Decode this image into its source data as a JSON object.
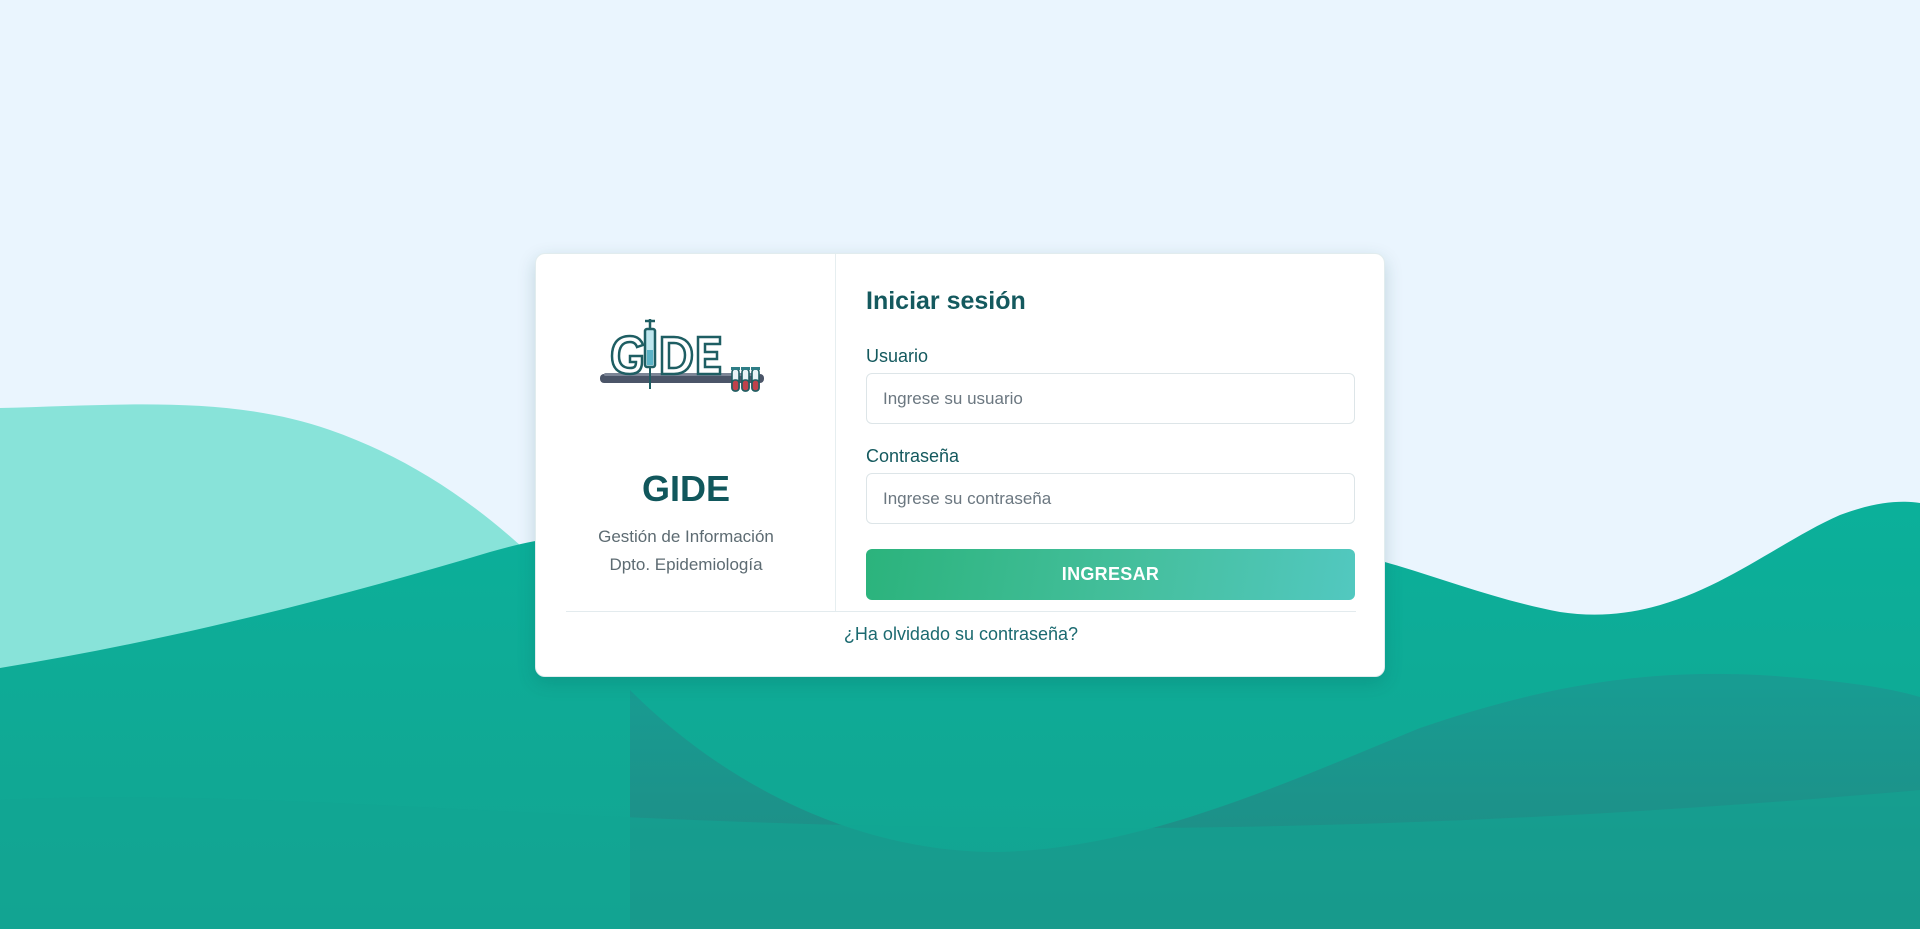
{
  "brand": {
    "logo_text": "GIDE",
    "name": "GIDE",
    "subtitle_line1": "Gestión de Información",
    "subtitle_line2": "Dpto. Epidemiología"
  },
  "login": {
    "title": "Iniciar sesión",
    "username_label": "Usuario",
    "username_placeholder": "Ingrese su usuario",
    "username_value": "",
    "password_label": "Contraseña",
    "password_placeholder": "Ingrese su contraseña",
    "password_value": "",
    "submit_label": "INGRESAR",
    "forgot_link": "¿Ha olvidado su contraseña?"
  },
  "icons": {
    "logo": "syringe-test-tubes-logo"
  },
  "colors": {
    "background": "#eaf5fe",
    "wave_light": "#88e3d9",
    "wave_main": "#0fae98",
    "wave_dark": "#1e8b89",
    "brand_text": "#11575c",
    "button_start": "#2bb37c",
    "button_end": "#52c8c0"
  }
}
